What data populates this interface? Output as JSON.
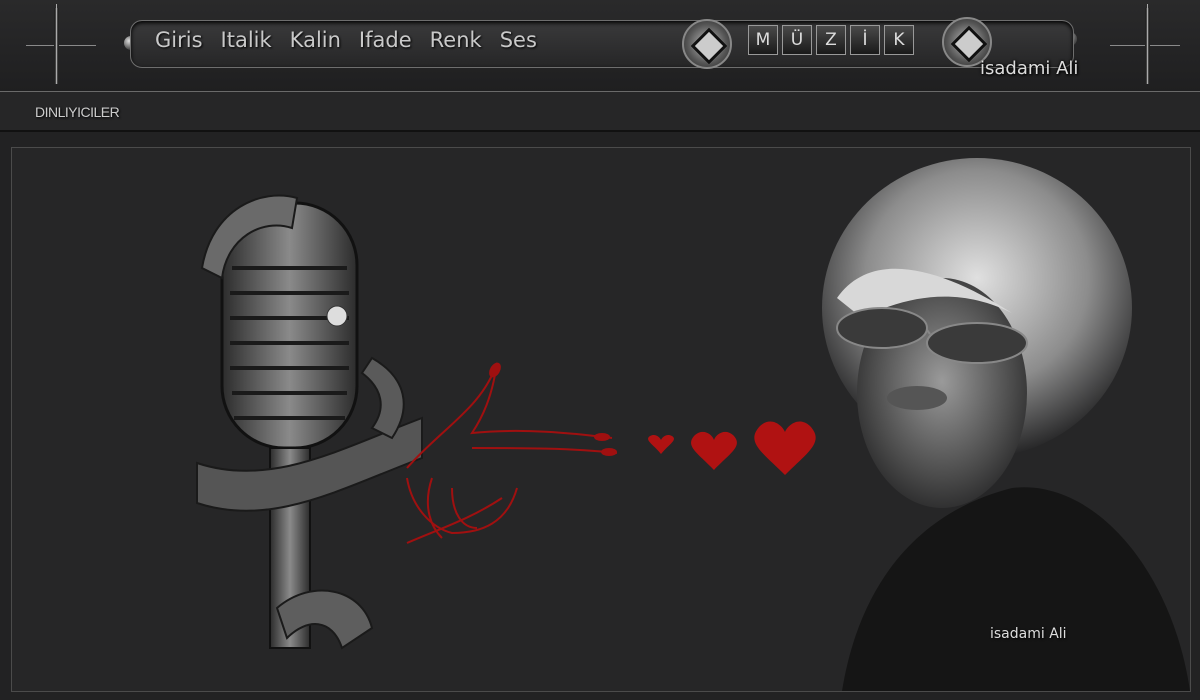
{
  "nav": {
    "items": [
      "Giris",
      "Italik",
      "Kalin",
      "Ifade",
      "Renk",
      "Ses"
    ]
  },
  "music_letters": [
    "M",
    "Ü",
    "Z",
    "İ",
    "K"
  ],
  "signature": "isadami Ali",
  "listeners_label": "DINLIYICILER",
  "main": {
    "signature": "isadami Ali"
  },
  "colors": {
    "background": "#222223",
    "heart_red": "#b01212",
    "text": "#c9c9c9"
  }
}
